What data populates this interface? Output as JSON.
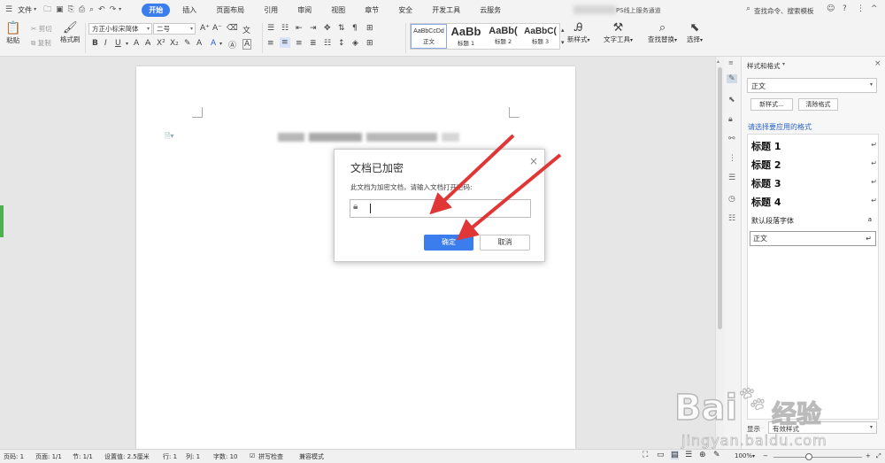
{
  "menubar": {
    "file_label": "文件",
    "tabs": [
      {
        "label": "开始",
        "active": true
      },
      {
        "label": "插入",
        "active": false
      },
      {
        "label": "页面布局",
        "active": false
      },
      {
        "label": "引用",
        "active": false
      },
      {
        "label": "审阅",
        "active": false
      },
      {
        "label": "视图",
        "active": false
      },
      {
        "label": "章节",
        "active": false
      },
      {
        "label": "安全",
        "active": false
      },
      {
        "label": "开发工具",
        "active": false
      },
      {
        "label": "云服务",
        "active": false
      }
    ],
    "promo_text": "PS线上服务通道",
    "search_text": "查找命令、搜索模板"
  },
  "ribbon": {
    "paste_label": "粘贴",
    "cut_label": "剪切",
    "copy_label": "复制",
    "format_painter_label": "格式刷",
    "font_name": "方正小标宋简体",
    "font_size": "二号",
    "styles": [
      {
        "preview": "AaBbCcDd",
        "label": "正文"
      },
      {
        "preview": "AaBb",
        "label": "标题 1"
      },
      {
        "preview": "AaBb(",
        "label": "标题 2"
      },
      {
        "preview": "AaBbC(",
        "label": "标题 3"
      }
    ],
    "new_style_label": "新样式",
    "text_tools_label": "文字工具",
    "find_replace_label": "查找替换",
    "select_label": "选择"
  },
  "dialog": {
    "title": "文档已加密",
    "message": "此文档为加密文档，请输入文档打开密码:",
    "password_value": "",
    "ok_label": "确定",
    "cancel_label": "取消"
  },
  "side_panel": {
    "title": "样式和格式",
    "current_style": "正文",
    "new_style_button": "新样式...",
    "clear_format_button": "清除格式",
    "prompt": "请选择要应用的格式",
    "styles": [
      "标题 1",
      "标题 2",
      "标题 3",
      "标题 4"
    ],
    "default_font_label": "默认段落字体",
    "body_style": "正文",
    "show_label": "显示",
    "show_value": "有效样式"
  },
  "statusbar": {
    "page_num": "页码: 1",
    "page_of": "页面: 1/1",
    "section": "节: 1/1",
    "setting": "设置值: 2.5厘米",
    "row": "行: 1",
    "col": "列: 1",
    "word_count": "字数: 10",
    "spell_check": "拼写检查",
    "compat_mode": "兼容模式",
    "zoom": "100%"
  },
  "watermark": {
    "brand": "Bai",
    "brand_cn": "经验",
    "url": "jingyan.baidu.com"
  },
  "colors": {
    "accent": "#3b7ded",
    "arrow": "#e03636",
    "panel_link": "#2b63c7"
  }
}
